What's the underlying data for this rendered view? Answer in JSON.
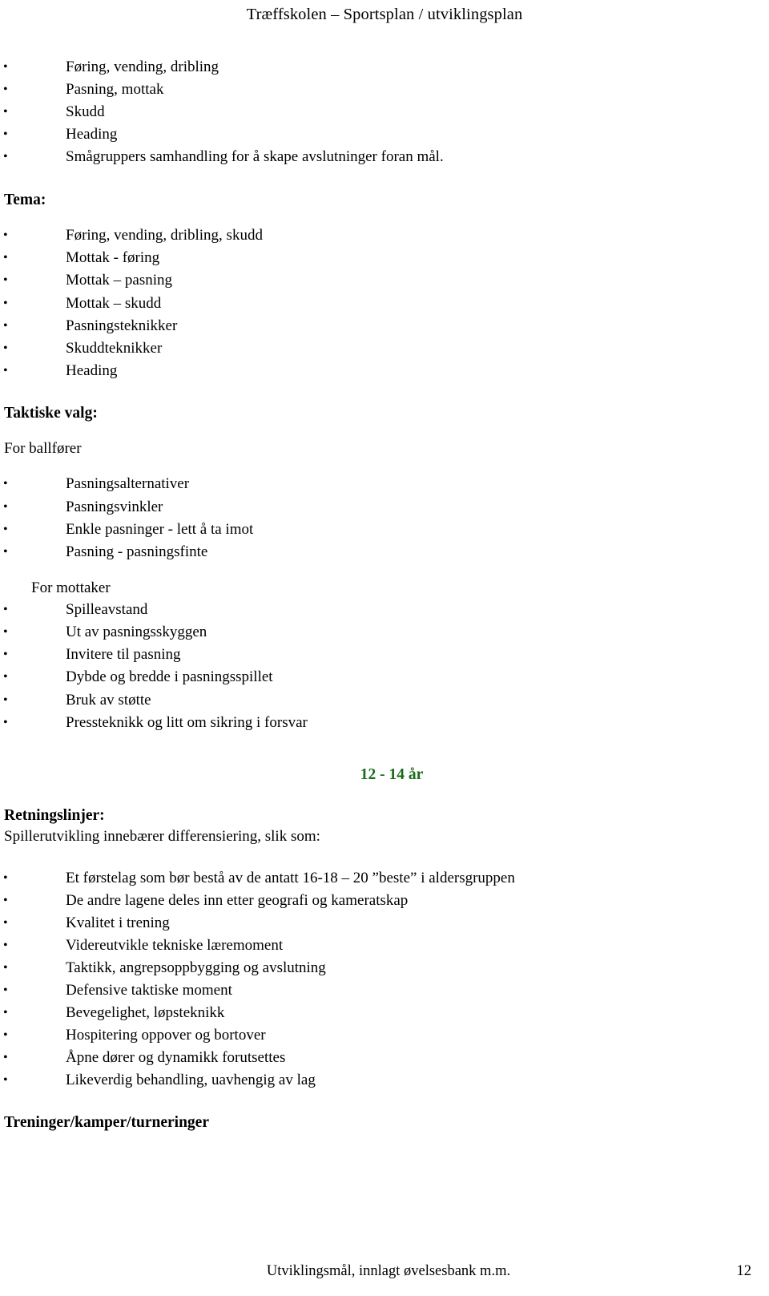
{
  "document": {
    "title": "Træffskolen – Sportsplan / utviklingsplan",
    "page_number": "12",
    "footer_text": "Utviklingsmål, innlagt øvelsesbank m.m.",
    "accent_color": "#1a6b1a",
    "text_color": "#000000",
    "background_color": "#ffffff"
  },
  "intro_list": {
    "items": [
      "Føring, vending, dribling",
      "Pasning, mottak",
      "Skudd",
      "Heading",
      "Smågruppers samhandling for å skape avslutninger foran mål."
    ]
  },
  "tema": {
    "heading": "Tema:",
    "items": [
      "Føring, vending, dribling, skudd",
      "Mottak - føring",
      "Mottak – pasning",
      "Mottak – skudd",
      "Pasningsteknikker",
      "Skuddteknikker",
      "Heading"
    ]
  },
  "taktiske_valg": {
    "heading": "Taktiske valg:",
    "for_ballforer": {
      "label": "For ballfører",
      "items": [
        "Pasningsalternativer",
        "Pasningsvinkler",
        "Enkle pasninger - lett å ta imot",
        "Pasning - pasningsfinte"
      ]
    },
    "for_mottaker": {
      "label": "For mottaker",
      "items": [
        "Spilleavstand",
        "Ut av pasningsskyggen",
        "Invitere til pasning",
        "Dybde og bredde i pasningsspillet",
        "Bruk av støtte",
        "Pressteknikk og litt om sikring i forsvar"
      ]
    }
  },
  "age_group": {
    "label": "12 - 14 år"
  },
  "retningslinjer": {
    "heading": "Retningslinjer:",
    "subtitle": "Spillerutvikling innebærer differensiering, slik som:",
    "items": [
      "Et førstelag som bør bestå av de antatt 16-18 – 20 ”beste” i aldersgruppen",
      "De andre lagene deles inn etter geografi og kameratskap",
      "Kvalitet i trening",
      "Videreutvikle tekniske læremoment",
      "Taktikk, angrepsoppbygging og avslutning",
      "Defensive taktiske moment",
      "Bevegelighet, løpsteknikk",
      "Hospitering oppover og bortover",
      "Åpne dører og dynamikk forutsettes",
      "Likeverdig behandling, uavhengig av lag"
    ]
  },
  "treninger": {
    "heading": "Treninger/kamper/turneringer"
  }
}
